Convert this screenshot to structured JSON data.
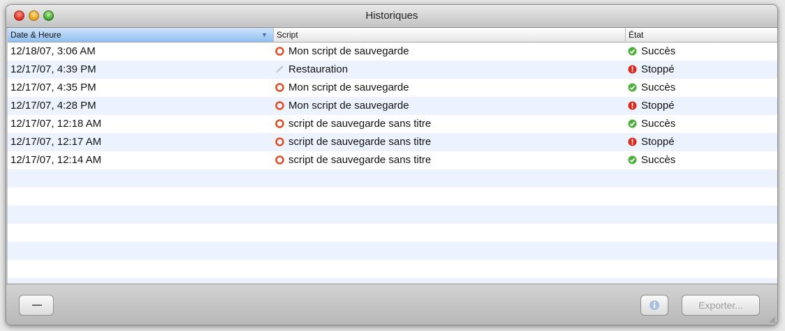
{
  "window": {
    "title": "Historiques"
  },
  "table": {
    "columns": [
      "Date & Heure",
      "Script",
      "État"
    ],
    "sorted_column": "Date & Heure",
    "rows": [
      {
        "date": "12/18/07, 3:06 AM",
        "script": "Mon script de sauvegarde",
        "script_icon": "backup-icon",
        "state": "Succès",
        "state_icon": "success-check-icon"
      },
      {
        "date": "12/17/07, 4:39 PM",
        "script": "Restauration",
        "script_icon": "restore-icon",
        "state": "Stoppé",
        "state_icon": "stopped-alert-icon"
      },
      {
        "date": "12/17/07, 4:35 PM",
        "script": "Mon script de sauvegarde",
        "script_icon": "backup-icon",
        "state": "Succès",
        "state_icon": "success-check-icon"
      },
      {
        "date": "12/17/07, 4:28 PM",
        "script": "Mon script de sauvegarde",
        "script_icon": "backup-icon",
        "state": "Stoppé",
        "state_icon": "stopped-alert-icon"
      },
      {
        "date": "12/17/07, 12:18 AM",
        "script": "script de sauvegarde sans titre",
        "script_icon": "backup-icon",
        "state": "Succès",
        "state_icon": "success-check-icon"
      },
      {
        "date": "12/17/07, 12:17 AM",
        "script": "script de sauvegarde sans titre",
        "script_icon": "backup-icon",
        "state": "Stoppé",
        "state_icon": "stopped-alert-icon"
      },
      {
        "date": "12/17/07, 12:14 AM",
        "script": "script de sauvegarde sans titre",
        "script_icon": "backup-icon",
        "state": "Succès",
        "state_icon": "success-check-icon"
      }
    ]
  },
  "footer": {
    "remove_icon": "minus-icon",
    "info_icon": "info-icon",
    "export_label": "Exporter..."
  },
  "colors": {
    "success": "#4caf3a",
    "stopped": "#d9281c",
    "backup": "#e2502a",
    "selection_header": "#8fbff0",
    "alt_row": "#edf3fe"
  }
}
